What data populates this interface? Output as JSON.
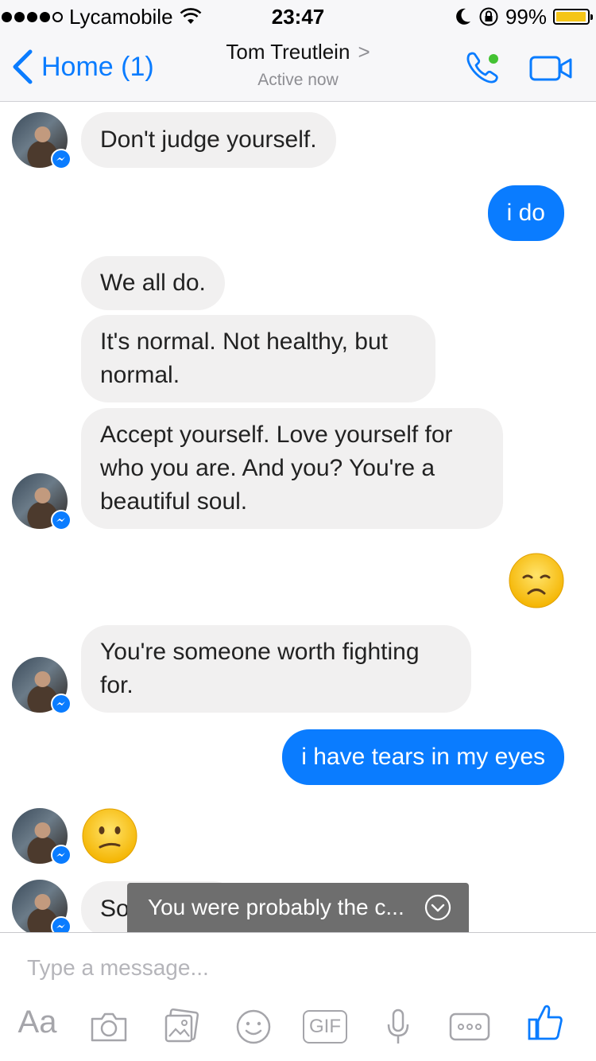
{
  "status_bar": {
    "carrier": "Lycamobile",
    "time": "23:47",
    "battery": "99%"
  },
  "nav": {
    "back_label": "Home (1)",
    "contact_name": "Tom Treutlein",
    "contact_status": "Active now"
  },
  "messages": [
    {
      "from": "them",
      "text": "Don't judge yourself."
    },
    {
      "from": "me",
      "text": "i do"
    },
    {
      "from": "them",
      "text": "We all do."
    },
    {
      "from": "them",
      "text": "It's normal. Not healthy, but normal."
    },
    {
      "from": "them",
      "text": "Accept yourself. Love yourself for who you are. And you? You're a beautiful soul."
    },
    {
      "from": "me",
      "emoji": "disappointed-face"
    },
    {
      "from": "them",
      "text": "You're someone worth fighting for."
    },
    {
      "from": "me",
      "text": "i have tears in my eyes"
    },
    {
      "from": "them",
      "emoji": "confused-face"
    },
    {
      "from": "them",
      "text": "So"
    }
  ],
  "toast": {
    "text": "You were probably the c..."
  },
  "composer": {
    "placeholder": "Type a message...",
    "tools": [
      "Aa",
      "camera-icon",
      "photo-icon",
      "emoji-icon",
      "GIF",
      "microphone-icon",
      "more-icon",
      "like-icon"
    ]
  },
  "colors": {
    "accent": "#0a7cff",
    "incoming_bubble": "#f1f0f0",
    "online_dot": "#44c233"
  }
}
